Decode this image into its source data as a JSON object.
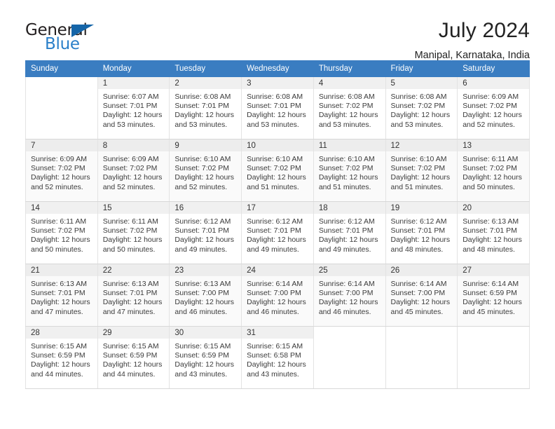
{
  "brand": {
    "name_part1": "General",
    "name_part2": "Blue"
  },
  "header": {
    "title": "July 2024",
    "subtitle": "Manipal, Karnataka, India"
  },
  "calendar": {
    "weekday_headers": [
      "Sunday",
      "Monday",
      "Tuesday",
      "Wednesday",
      "Thursday",
      "Friday",
      "Saturday"
    ],
    "labels": {
      "sunrise": "Sunrise:",
      "sunset": "Sunset:",
      "daylight": "Daylight:"
    },
    "accent_color": "#3a7dc1",
    "weeks": [
      [
        {
          "day": "",
          "empty": true
        },
        {
          "day": "1",
          "sunrise": "Sunrise: 6:07 AM",
          "sunset": "Sunset: 7:01 PM",
          "daylight1": "Daylight: 12 hours",
          "daylight2": "and 53 minutes."
        },
        {
          "day": "2",
          "sunrise": "Sunrise: 6:08 AM",
          "sunset": "Sunset: 7:01 PM",
          "daylight1": "Daylight: 12 hours",
          "daylight2": "and 53 minutes."
        },
        {
          "day": "3",
          "sunrise": "Sunrise: 6:08 AM",
          "sunset": "Sunset: 7:01 PM",
          "daylight1": "Daylight: 12 hours",
          "daylight2": "and 53 minutes."
        },
        {
          "day": "4",
          "sunrise": "Sunrise: 6:08 AM",
          "sunset": "Sunset: 7:02 PM",
          "daylight1": "Daylight: 12 hours",
          "daylight2": "and 53 minutes."
        },
        {
          "day": "5",
          "sunrise": "Sunrise: 6:08 AM",
          "sunset": "Sunset: 7:02 PM",
          "daylight1": "Daylight: 12 hours",
          "daylight2": "and 53 minutes."
        },
        {
          "day": "6",
          "sunrise": "Sunrise: 6:09 AM",
          "sunset": "Sunset: 7:02 PM",
          "daylight1": "Daylight: 12 hours",
          "daylight2": "and 52 minutes."
        }
      ],
      [
        {
          "day": "7",
          "sunrise": "Sunrise: 6:09 AM",
          "sunset": "Sunset: 7:02 PM",
          "daylight1": "Daylight: 12 hours",
          "daylight2": "and 52 minutes."
        },
        {
          "day": "8",
          "sunrise": "Sunrise: 6:09 AM",
          "sunset": "Sunset: 7:02 PM",
          "daylight1": "Daylight: 12 hours",
          "daylight2": "and 52 minutes."
        },
        {
          "day": "9",
          "sunrise": "Sunrise: 6:10 AM",
          "sunset": "Sunset: 7:02 PM",
          "daylight1": "Daylight: 12 hours",
          "daylight2": "and 52 minutes."
        },
        {
          "day": "10",
          "sunrise": "Sunrise: 6:10 AM",
          "sunset": "Sunset: 7:02 PM",
          "daylight1": "Daylight: 12 hours",
          "daylight2": "and 51 minutes."
        },
        {
          "day": "11",
          "sunrise": "Sunrise: 6:10 AM",
          "sunset": "Sunset: 7:02 PM",
          "daylight1": "Daylight: 12 hours",
          "daylight2": "and 51 minutes."
        },
        {
          "day": "12",
          "sunrise": "Sunrise: 6:10 AM",
          "sunset": "Sunset: 7:02 PM",
          "daylight1": "Daylight: 12 hours",
          "daylight2": "and 51 minutes."
        },
        {
          "day": "13",
          "sunrise": "Sunrise: 6:11 AM",
          "sunset": "Sunset: 7:02 PM",
          "daylight1": "Daylight: 12 hours",
          "daylight2": "and 50 minutes."
        }
      ],
      [
        {
          "day": "14",
          "sunrise": "Sunrise: 6:11 AM",
          "sunset": "Sunset: 7:02 PM",
          "daylight1": "Daylight: 12 hours",
          "daylight2": "and 50 minutes."
        },
        {
          "day": "15",
          "sunrise": "Sunrise: 6:11 AM",
          "sunset": "Sunset: 7:02 PM",
          "daylight1": "Daylight: 12 hours",
          "daylight2": "and 50 minutes."
        },
        {
          "day": "16",
          "sunrise": "Sunrise: 6:12 AM",
          "sunset": "Sunset: 7:01 PM",
          "daylight1": "Daylight: 12 hours",
          "daylight2": "and 49 minutes."
        },
        {
          "day": "17",
          "sunrise": "Sunrise: 6:12 AM",
          "sunset": "Sunset: 7:01 PM",
          "daylight1": "Daylight: 12 hours",
          "daylight2": "and 49 minutes."
        },
        {
          "day": "18",
          "sunrise": "Sunrise: 6:12 AM",
          "sunset": "Sunset: 7:01 PM",
          "daylight1": "Daylight: 12 hours",
          "daylight2": "and 49 minutes."
        },
        {
          "day": "19",
          "sunrise": "Sunrise: 6:12 AM",
          "sunset": "Sunset: 7:01 PM",
          "daylight1": "Daylight: 12 hours",
          "daylight2": "and 48 minutes."
        },
        {
          "day": "20",
          "sunrise": "Sunrise: 6:13 AM",
          "sunset": "Sunset: 7:01 PM",
          "daylight1": "Daylight: 12 hours",
          "daylight2": "and 48 minutes."
        }
      ],
      [
        {
          "day": "21",
          "sunrise": "Sunrise: 6:13 AM",
          "sunset": "Sunset: 7:01 PM",
          "daylight1": "Daylight: 12 hours",
          "daylight2": "and 47 minutes."
        },
        {
          "day": "22",
          "sunrise": "Sunrise: 6:13 AM",
          "sunset": "Sunset: 7:01 PM",
          "daylight1": "Daylight: 12 hours",
          "daylight2": "and 47 minutes."
        },
        {
          "day": "23",
          "sunrise": "Sunrise: 6:13 AM",
          "sunset": "Sunset: 7:00 PM",
          "daylight1": "Daylight: 12 hours",
          "daylight2": "and 46 minutes."
        },
        {
          "day": "24",
          "sunrise": "Sunrise: 6:14 AM",
          "sunset": "Sunset: 7:00 PM",
          "daylight1": "Daylight: 12 hours",
          "daylight2": "and 46 minutes."
        },
        {
          "day": "25",
          "sunrise": "Sunrise: 6:14 AM",
          "sunset": "Sunset: 7:00 PM",
          "daylight1": "Daylight: 12 hours",
          "daylight2": "and 46 minutes."
        },
        {
          "day": "26",
          "sunrise": "Sunrise: 6:14 AM",
          "sunset": "Sunset: 7:00 PM",
          "daylight1": "Daylight: 12 hours",
          "daylight2": "and 45 minutes."
        },
        {
          "day": "27",
          "sunrise": "Sunrise: 6:14 AM",
          "sunset": "Sunset: 6:59 PM",
          "daylight1": "Daylight: 12 hours",
          "daylight2": "and 45 minutes."
        }
      ],
      [
        {
          "day": "28",
          "sunrise": "Sunrise: 6:15 AM",
          "sunset": "Sunset: 6:59 PM",
          "daylight1": "Daylight: 12 hours",
          "daylight2": "and 44 minutes."
        },
        {
          "day": "29",
          "sunrise": "Sunrise: 6:15 AM",
          "sunset": "Sunset: 6:59 PM",
          "daylight1": "Daylight: 12 hours",
          "daylight2": "and 44 minutes."
        },
        {
          "day": "30",
          "sunrise": "Sunrise: 6:15 AM",
          "sunset": "Sunset: 6:59 PM",
          "daylight1": "Daylight: 12 hours",
          "daylight2": "and 43 minutes."
        },
        {
          "day": "31",
          "sunrise": "Sunrise: 6:15 AM",
          "sunset": "Sunset: 6:58 PM",
          "daylight1": "Daylight: 12 hours",
          "daylight2": "and 43 minutes."
        },
        {
          "day": "",
          "empty": true
        },
        {
          "day": "",
          "empty": true
        },
        {
          "day": "",
          "empty": true
        }
      ]
    ]
  }
}
